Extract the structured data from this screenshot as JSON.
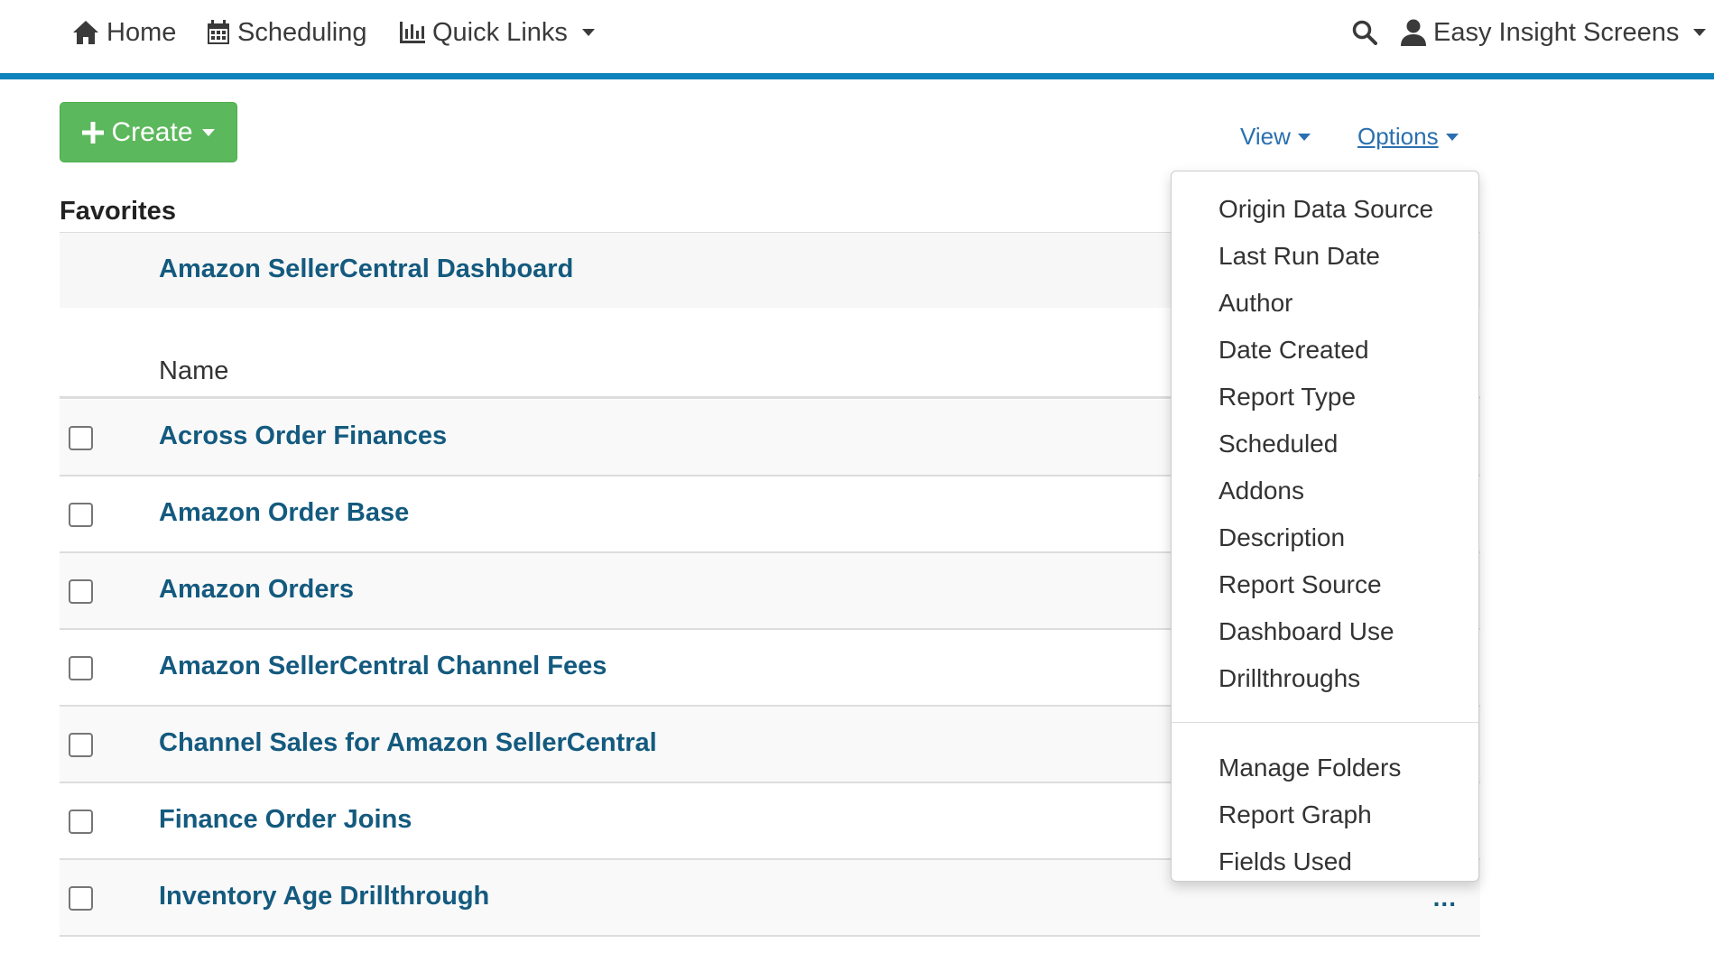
{
  "nav": {
    "home": "Home",
    "scheduling": "Scheduling",
    "quick_links": "Quick Links",
    "user": "Easy Insight Screens"
  },
  "toolbar": {
    "create": "Create",
    "view": "View",
    "options": "Options"
  },
  "favorites": {
    "title": "Favorites",
    "items": [
      "Amazon SellerCentral Dashboard"
    ]
  },
  "table": {
    "name_header": "Name",
    "rows": [
      "Across Order Finances",
      "Amazon Order Base",
      "Amazon Orders",
      "Amazon SellerCentral Channel Fees",
      "Channel Sales for Amazon SellerCentral",
      "Finance Order Joins",
      "Inventory Age Drillthrough"
    ],
    "row_actions": "..."
  },
  "options_menu": {
    "columns": [
      "Origin Data Source",
      "Last Run Date",
      "Author",
      "Date Created",
      "Report Type",
      "Scheduled",
      "Addons",
      "Description",
      "Report Source",
      "Dashboard Use",
      "Drillthroughs"
    ],
    "actions": [
      "Manage Folders",
      "Report Graph",
      "Fields Used"
    ]
  },
  "colors": {
    "accent_bar": "#0e82bd",
    "create_button": "#5cb85c",
    "link": "#145a7f",
    "toolbar_link": "#2a6fb0"
  },
  "icons": {
    "home": "home-icon",
    "scheduling": "calendar-icon",
    "quick_links": "bar-chart-icon",
    "search": "search-icon",
    "user": "user-icon",
    "create": "plus-icon"
  }
}
